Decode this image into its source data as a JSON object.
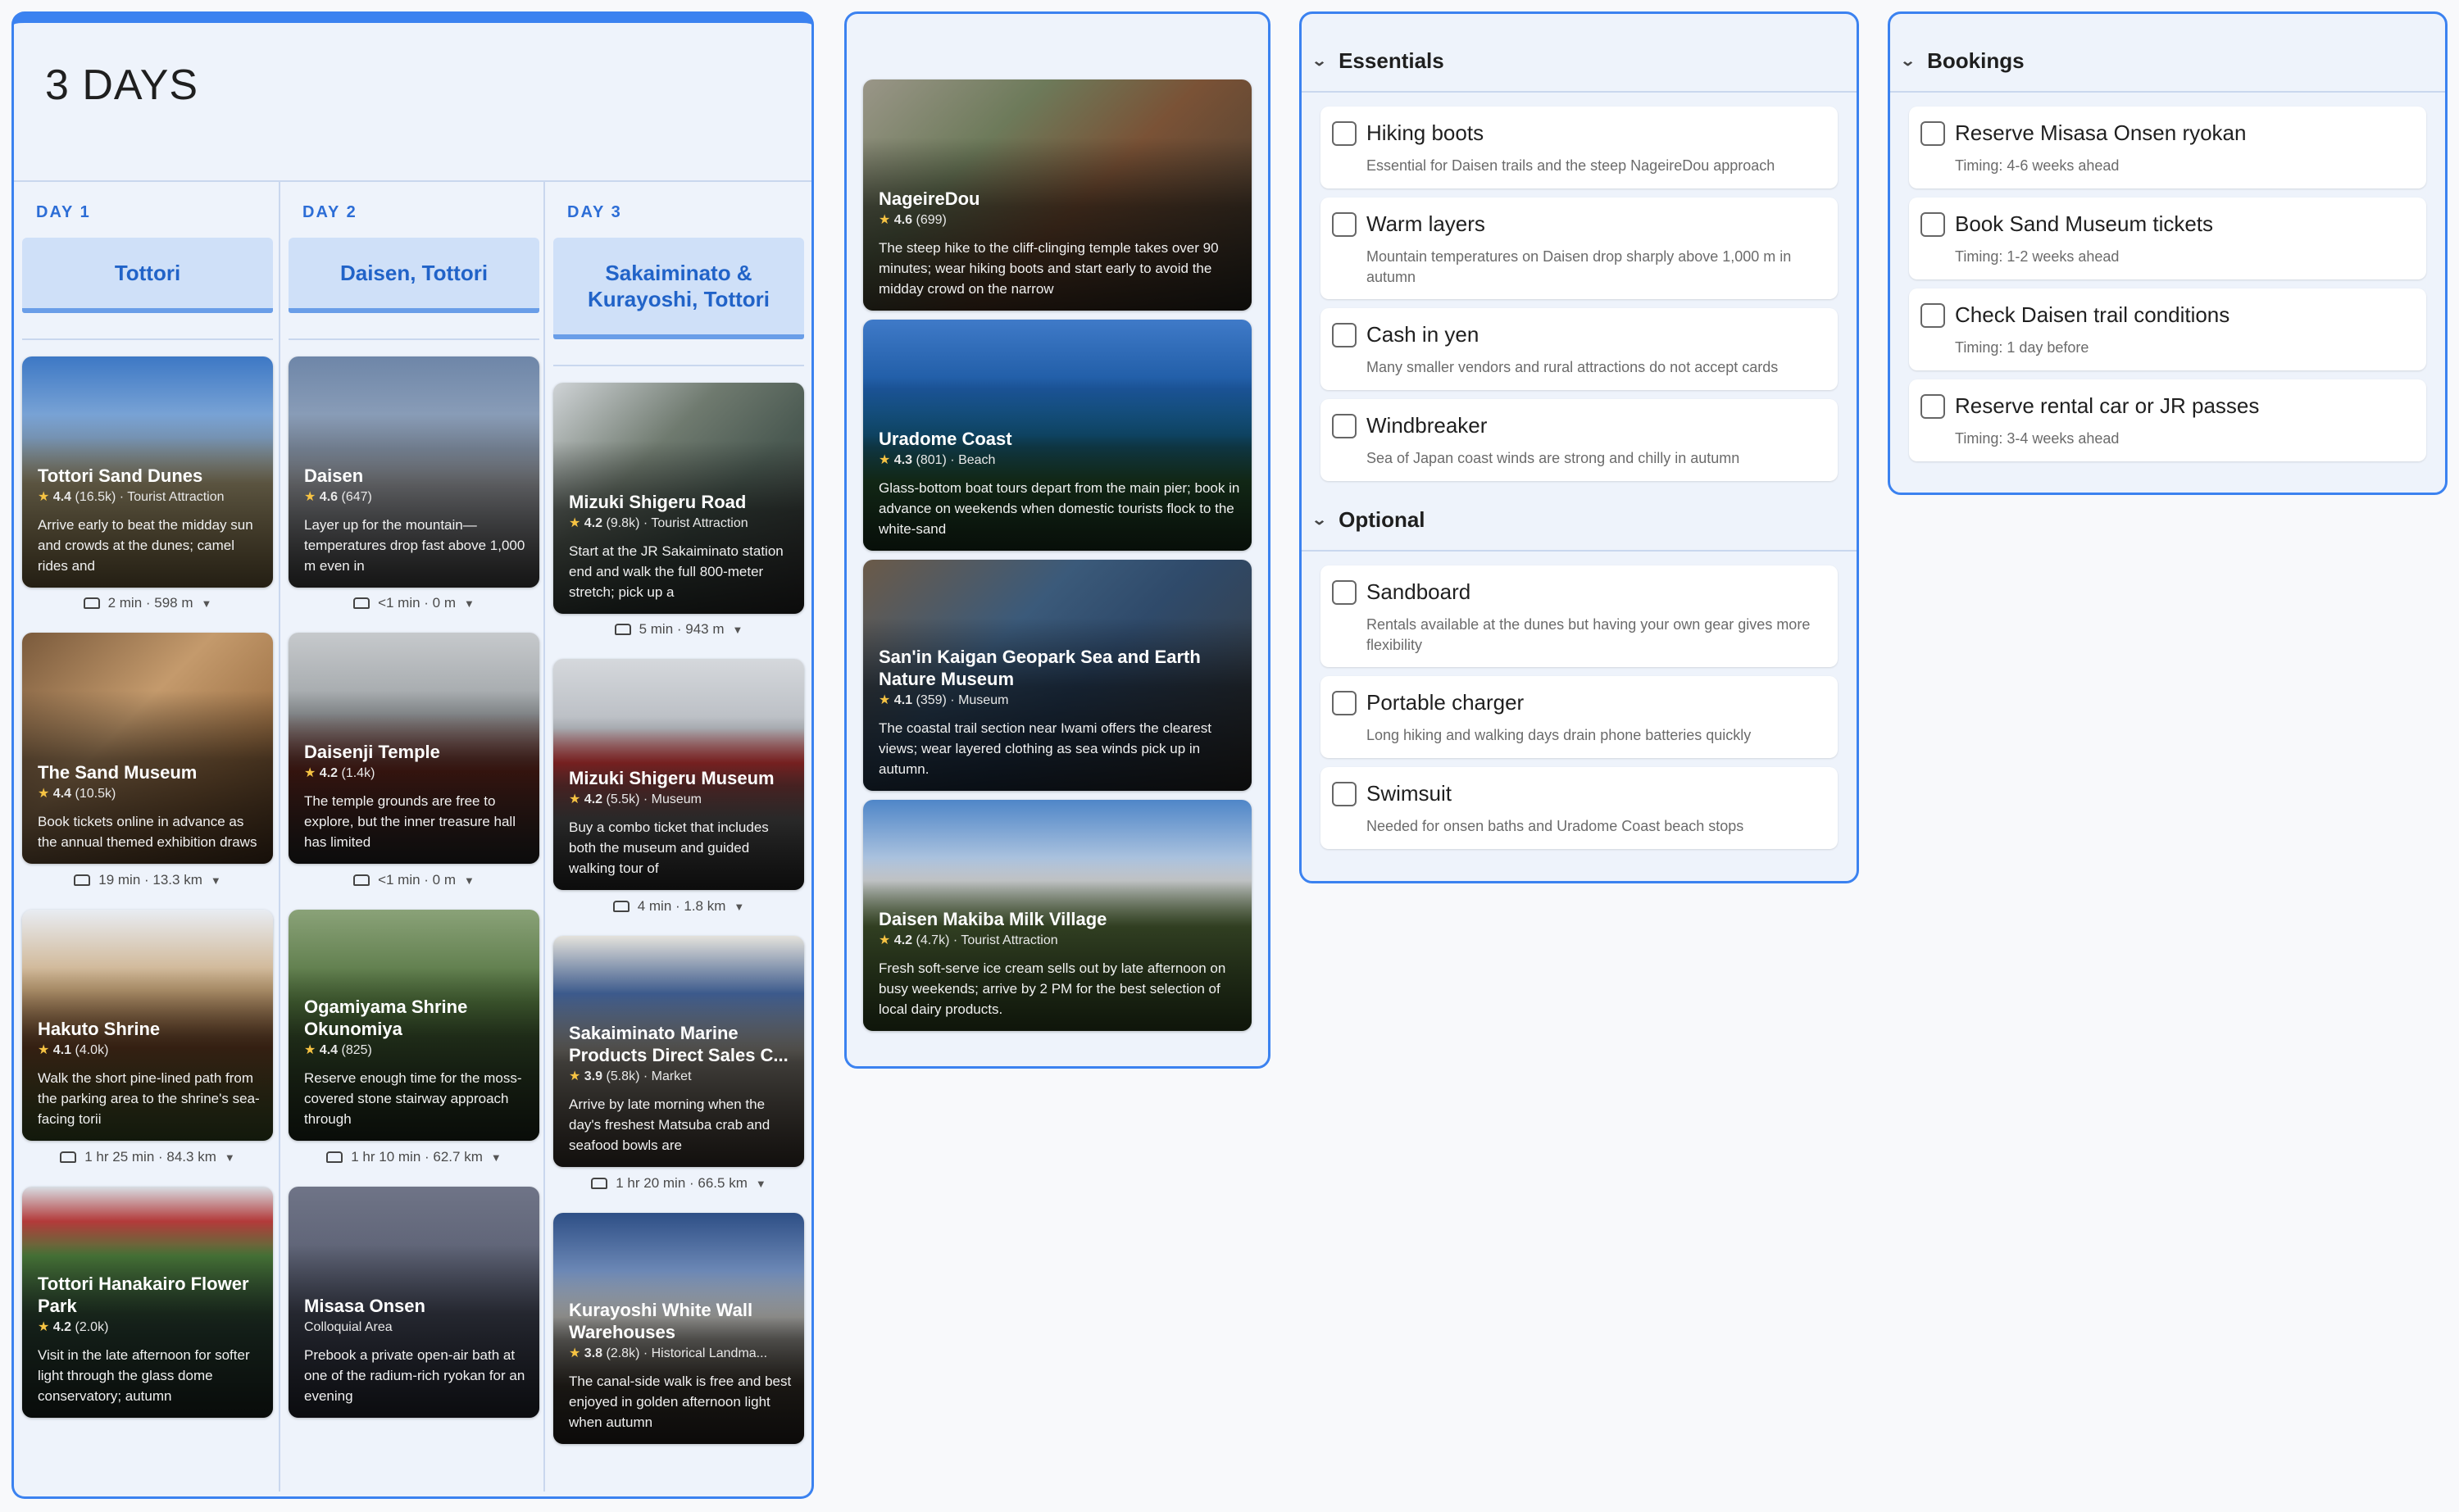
{
  "trip_title": "3 DAYS",
  "days": [
    {
      "label": "DAY 1",
      "title": "Tottori",
      "places": [
        {
          "name": "Tottori Sand Dunes",
          "rating": "4.4",
          "reviews": "(16.5k)",
          "category": "Tourist Attraction",
          "desc": "Arrive early to beat the midday sun and crowds at the dunes; camel rides and",
          "travel": "2 min · 598 m"
        },
        {
          "name": "The Sand Museum",
          "rating": "4.4",
          "reviews": "(10.5k)",
          "category": "",
          "desc": "Book tickets online in advance as the annual themed exhibition draws",
          "travel": "19 min · 13.3 km"
        },
        {
          "name": "Hakuto Shrine",
          "rating": "4.1",
          "reviews": "(4.0k)",
          "category": "",
          "desc": "Walk the short pine-lined path from the parking area to the shrine's sea-facing torii",
          "travel": "1 hr 25 min · 84.3 km"
        },
        {
          "name": "Tottori Hanakairo Flower Park",
          "rating": "4.2",
          "reviews": "(2.0k)",
          "category": "",
          "desc": "Visit in the late afternoon for softer light through the glass dome conservatory; autumn",
          "travel": ""
        }
      ]
    },
    {
      "label": "DAY 2",
      "title": "Daisen, Tottori",
      "places": [
        {
          "name": "Daisen",
          "rating": "4.6",
          "reviews": "(647)",
          "category": "",
          "desc": "Layer up for the mountain—temperatures drop fast above 1,000 m even in",
          "travel": "<1 min · 0 m"
        },
        {
          "name": "Daisenji Temple",
          "rating": "4.2",
          "reviews": "(1.4k)",
          "category": "",
          "desc": "The temple grounds are free to explore, but the inner treasure hall has limited",
          "travel": "<1 min · 0 m"
        },
        {
          "name": "Ogamiyama Shrine Okunomiya",
          "rating": "4.4",
          "reviews": "(825)",
          "category": "",
          "desc": "Reserve enough time for the moss-covered stone stairway approach through",
          "travel": "1 hr 10 min · 62.7 km"
        },
        {
          "name": "Misasa Onsen",
          "rating": "",
          "reviews": "",
          "category": "Colloquial Area",
          "desc": "Prebook a private open-air bath at one of the radium-rich ryokan for an evening",
          "travel": ""
        }
      ]
    },
    {
      "label": "DAY 3",
      "title": "Sakaiminato & Kurayoshi, Tottori",
      "places": [
        {
          "name": "Mizuki Shigeru Road",
          "rating": "4.2",
          "reviews": "(9.8k)",
          "category": "Tourist Attraction",
          "desc": "Start at the JR Sakaiminato station end and walk the full 800-meter stretch; pick up a",
          "travel": "5 min · 943 m"
        },
        {
          "name": "Mizuki Shigeru Museum",
          "rating": "4.2",
          "reviews": "(5.5k)",
          "category": "Museum",
          "desc": "Buy a combo ticket that includes both the museum and guided walking tour of",
          "travel": "4 min · 1.8 km"
        },
        {
          "name": "Sakaiminato Marine Products Direct Sales C...",
          "rating": "3.9",
          "reviews": "(5.8k)",
          "category": "Market",
          "desc": "Arrive by late morning when the day's freshest Matsuba crab and seafood bowls are",
          "travel": "1 hr 20 min · 66.5 km"
        },
        {
          "name": "Kurayoshi White Wall Warehouses",
          "rating": "3.8",
          "reviews": "(2.8k)",
          "category": "Historical Landma...",
          "desc": "The canal-side walk is free and best enjoyed in golden afternoon light when autumn",
          "travel": ""
        }
      ]
    }
  ],
  "extra_places": [
    {
      "name": "NageireDou",
      "rating": "4.6",
      "reviews": "(699)",
      "category": "",
      "desc": "The steep hike to the cliff-clinging temple takes over 90 minutes; wear hiking boots and start early to avoid the midday crowd on the narrow"
    },
    {
      "name": "Uradome Coast",
      "rating": "4.3",
      "reviews": "(801)",
      "category": "Beach",
      "desc": "Glass-bottom boat tours depart from the main pier; book in advance on weekends when domestic tourists flock to the white-sand"
    },
    {
      "name": "San'in Kaigan Geopark Sea and Earth Nature Museum",
      "rating": "4.1",
      "reviews": "(359)",
      "category": "Museum",
      "desc": "The coastal trail section near Iwami offers the clearest views; wear layered clothing as sea winds pick up in autumn."
    },
    {
      "name": "Daisen Makiba Milk Village",
      "rating": "4.2",
      "reviews": "(4.7k)",
      "category": "Tourist Attraction",
      "desc": "Fresh soft-serve ice cream sells out by late afternoon on busy weekends; arrive by 2 PM for the best selection of local dairy products."
    }
  ],
  "packing": {
    "essentials_title": "Essentials",
    "essentials": [
      {
        "title": "Hiking boots",
        "sub": "Essential for Daisen trails and the steep NageireDou approach"
      },
      {
        "title": "Warm layers",
        "sub": "Mountain temperatures on Daisen drop sharply above 1,000 m in autumn"
      },
      {
        "title": "Cash in yen",
        "sub": "Many smaller vendors and rural attractions do not accept cards"
      },
      {
        "title": "Windbreaker",
        "sub": "Sea of Japan coast winds are strong and chilly in autumn"
      }
    ],
    "optional_title": "Optional",
    "optional": [
      {
        "title": "Sandboard",
        "sub": "Rentals available at the dunes but having your own gear gives more flexibility"
      },
      {
        "title": "Portable charger",
        "sub": "Long hiking and walking days drain phone batteries quickly"
      },
      {
        "title": "Swimsuit",
        "sub": "Needed for onsen baths and Uradome Coast beach stops"
      }
    ]
  },
  "bookings": {
    "title": "Bookings",
    "items": [
      {
        "title": "Reserve Misasa Onsen ryokan",
        "sub": "Timing: 4-6 weeks ahead"
      },
      {
        "title": "Book Sand Museum tickets",
        "sub": "Timing: 1-2 weeks ahead"
      },
      {
        "title": "Check Daisen trail conditions",
        "sub": "Timing: 1 day before"
      },
      {
        "title": "Reserve rental car or JR passes",
        "sub": "Timing: 3-4 weeks ahead"
      }
    ]
  },
  "colors": {
    "accent": "#3b82f0",
    "panel_bg": "#eef3fb",
    "day_header_bg": "#cfe0f8",
    "star": "#f6c343"
  }
}
